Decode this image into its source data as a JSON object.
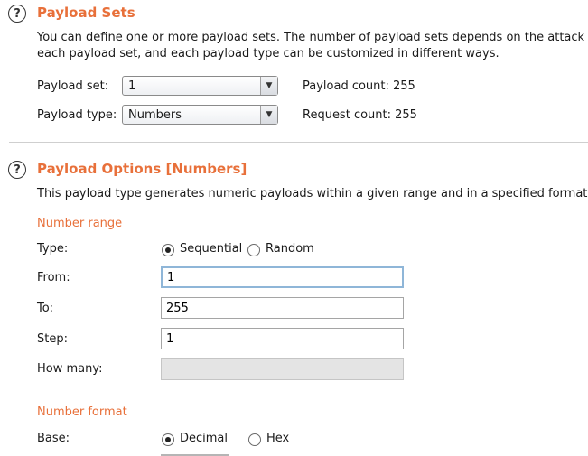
{
  "payload_sets": {
    "title": "Payload Sets",
    "desc_line1": "You can define one or more payload sets. The number of payload sets depends on the attack type",
    "desc_line2": "each payload set, and each payload type can be customized in different ways.",
    "set_label": "Payload set:",
    "set_value": "1",
    "type_label": "Payload type:",
    "type_value": "Numbers",
    "payload_count": "Payload count:  255",
    "request_count": "Request count: 255"
  },
  "payload_options": {
    "title": "Payload Options [Numbers]",
    "desc": "This payload type generates numeric payloads within a given range and in a specified format.",
    "number_range": {
      "heading": "Number range",
      "type_label": "Type:",
      "sequential": "Sequential",
      "random": "Random",
      "from_label": "From:",
      "from_value": "1",
      "to_label": "To:",
      "to_value": "255",
      "step_label": "Step:",
      "step_value": "1",
      "how_many_label": "How many:",
      "how_many_value": ""
    },
    "number_format": {
      "heading": "Number format",
      "base_label": "Base:",
      "decimal": "Decimal",
      "hex": "Hex"
    }
  },
  "icons": {
    "help": "?",
    "dropdown": "▼"
  }
}
